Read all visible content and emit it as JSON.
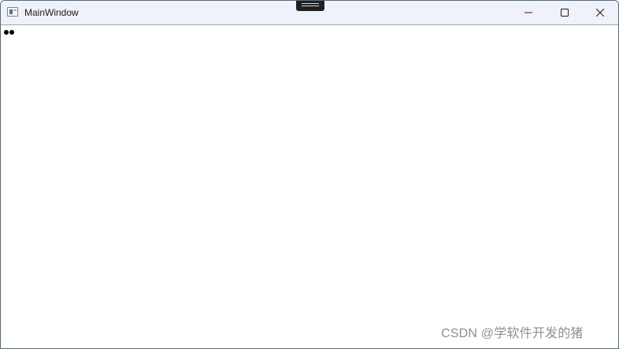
{
  "window": {
    "title": "MainWindow",
    "app_icon": "window-app-icon",
    "controls": {
      "minimize_icon": "minimize-icon",
      "maximize_icon": "maximize-icon",
      "close_icon": "close-icon"
    }
  },
  "content": {
    "text": "••"
  },
  "watermark": {
    "text": "CSDN @学软件开发的猪"
  },
  "colors": {
    "titlebar_background": "#eff2f8",
    "window_border": "#4a6f86",
    "content_background": "#ffffff",
    "watermark_text": "#8e8e8e"
  }
}
